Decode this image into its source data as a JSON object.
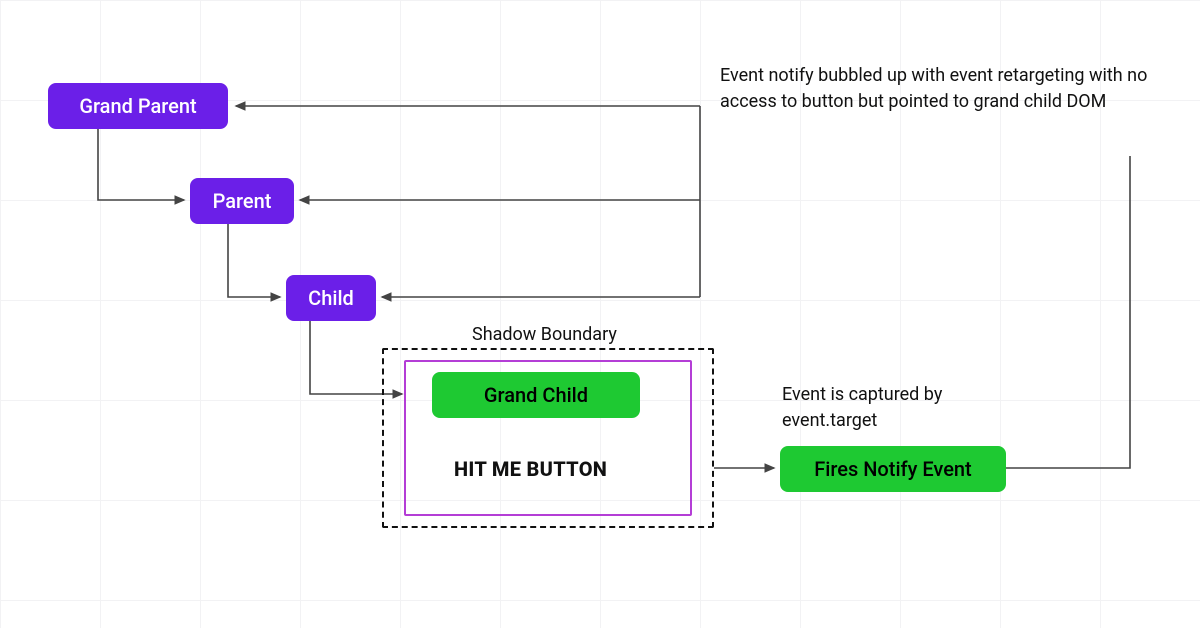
{
  "diagram": {
    "nodes": {
      "grandParent": "Grand Parent",
      "parent": "Parent",
      "child": "Child",
      "grandChild": "Grand Child",
      "hitButton": "HIT ME BUTTON",
      "firesNotify": "Fires Notify Event"
    },
    "labels": {
      "shadowBoundary": "Shadow Boundary",
      "captured": "Event is captured by event.target",
      "bubbled": "Event notify bubbled up with event retargeting with no access to button but pointed to grand child DOM"
    },
    "colors": {
      "purple": "#6b1fe8",
      "green": "#1ec932",
      "magenta": "#b43dd6",
      "edge": "#444"
    }
  }
}
